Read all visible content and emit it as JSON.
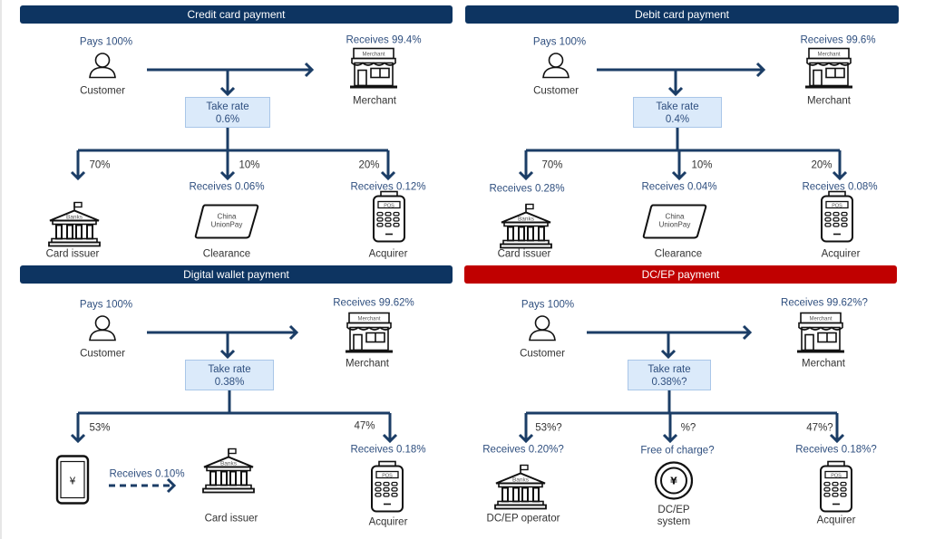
{
  "colors": {
    "header_navy": "#0d3461",
    "header_red": "#c00000",
    "arrow": "#1b3d66",
    "text_blue": "#2f4f7f",
    "take_rate_fill": "#dbeafa"
  },
  "panels": [
    {
      "title": "Credit card payment",
      "header_color": "#0d3461",
      "customer": {
        "pays": "Pays 100%",
        "label": "Customer",
        "icon": "person-icon"
      },
      "merchant": {
        "receives": "Receives 99.4%",
        "label": "Merchant",
        "icon": "store-icon",
        "sign": "Merchant"
      },
      "take_rate": {
        "label": "Take rate",
        "value": "0.6%"
      },
      "branches": [
        {
          "share": "70%",
          "receives": "",
          "label": "Card issuer",
          "icon": "bank-icon",
          "icon_text": "Banks"
        },
        {
          "share": "10%",
          "receives": "Receives 0.06%",
          "label": "Clearance",
          "icon": "unionpay-card-icon",
          "icon_text": "China UnionPay"
        },
        {
          "share": "20%",
          "receives": "Receives 0.12%",
          "label": "Acquirer",
          "icon": "pos-terminal-icon",
          "icon_text": "POS"
        }
      ]
    },
    {
      "title": "Debit card payment",
      "header_color": "#0d3461",
      "customer": {
        "pays": "Pays 100%",
        "label": "Customer",
        "icon": "person-icon"
      },
      "merchant": {
        "receives": "Receives 99.6%",
        "label": "Merchant",
        "icon": "store-icon",
        "sign": "Merchant"
      },
      "take_rate": {
        "label": "Take rate",
        "value": "0.4%"
      },
      "branches": [
        {
          "share": "70%",
          "receives": "Receives 0.28%",
          "label": "Card issuer",
          "icon": "bank-icon",
          "icon_text": "Banks"
        },
        {
          "share": "10%",
          "receives": "Receives 0.04%",
          "label": "Clearance",
          "icon": "unionpay-card-icon",
          "icon_text": "China UnionPay"
        },
        {
          "share": "20%",
          "receives": "Receives 0.08%",
          "label": "Acquirer",
          "icon": "pos-terminal-icon",
          "icon_text": "POS"
        }
      ]
    },
    {
      "title": "Digital wallet payment",
      "header_color": "#0d3461",
      "customer": {
        "pays": "Pays 100%",
        "label": "Customer",
        "icon": "person-icon"
      },
      "merchant": {
        "receives": "Receives 99.62%",
        "label": "Merchant",
        "icon": "store-icon",
        "sign": "Merchant"
      },
      "take_rate": {
        "label": "Take rate",
        "value": "0.38%"
      },
      "branches": [
        {
          "share": "53%",
          "receives": "",
          "label": "",
          "icon": "mobile-wallet-icon",
          "icon_text": "¥",
          "transfer": {
            "receives": "Receives 0.10%",
            "label": "Card issuer",
            "icon": "bank-icon",
            "icon_text": "Banks"
          }
        },
        {
          "share": "47%",
          "receives": "Receives 0.18%",
          "label": "Acquirer",
          "icon": "pos-terminal-icon",
          "icon_text": "POS"
        }
      ]
    },
    {
      "title": "DC/EP payment",
      "header_color": "#c00000",
      "customer": {
        "pays": "Pays 100%",
        "label": "Customer",
        "icon": "person-icon"
      },
      "merchant": {
        "receives": "Receives 99.62%?",
        "label": "Merchant",
        "icon": "store-icon",
        "sign": "Merchant"
      },
      "take_rate": {
        "label": "Take rate",
        "value": "0.38%?"
      },
      "branches": [
        {
          "share": "53%?",
          "receives": "Receives 0.20%?",
          "label": "DC/EP operator",
          "icon": "bank-icon",
          "icon_text": "Banks"
        },
        {
          "share": "%?",
          "receives": "Free of charge?",
          "label": "DC/EP\nsystem",
          "icon": "yuan-coin-icon",
          "icon_text": "¥"
        },
        {
          "share": "47%?",
          "receives": "Receives 0.18%?",
          "label": "Acquirer",
          "icon": "pos-terminal-icon",
          "icon_text": "POS"
        }
      ]
    }
  ]
}
